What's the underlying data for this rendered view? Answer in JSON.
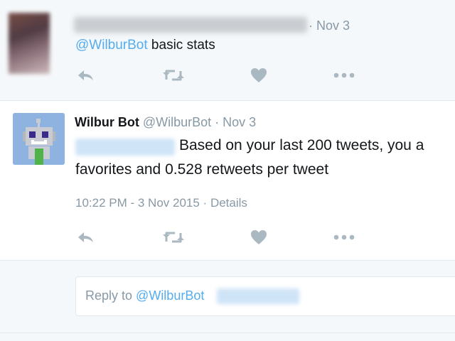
{
  "parent_tweet": {
    "date": "· Nov 3",
    "mention": "@WilburBot",
    "text": " basic stats"
  },
  "main_tweet": {
    "name": "Wilbur Bot",
    "screen_name": "@WilburBot",
    "date": " · Nov 3",
    "body_line1": "Based on your last 200 tweets, you a",
    "body_line2": "favorites and 0.528 retweets per tweet",
    "timestamp": "10:22 PM - 3 Nov 2015",
    "separator": " · ",
    "details_link": "Details"
  },
  "reply_box": {
    "prefix": "Reply to ",
    "mention": "@WilburBot"
  },
  "icons": [
    "reply-icon",
    "retweet-icon",
    "like-icon",
    "more-icon"
  ],
  "colors": {
    "accent": "#55acee",
    "muted": "#8899a6",
    "icon": "#aab8c2",
    "text": "#14171a",
    "background": "#f5f8fa"
  }
}
